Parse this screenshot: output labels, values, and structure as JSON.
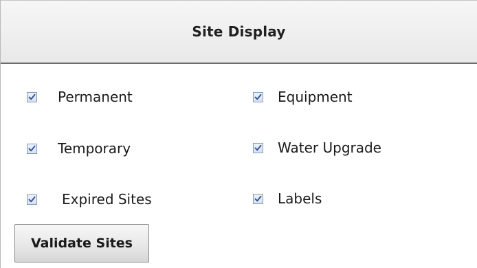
{
  "panel": {
    "title": "Site Display"
  },
  "options": [
    {
      "label": "Permanent",
      "checked": true
    },
    {
      "label": "Equipment",
      "checked": true
    },
    {
      "label": "Temporary",
      "checked": true
    },
    {
      "label": "Water Upgrade",
      "checked": true
    },
    {
      "label": "Expired Sites",
      "checked": true
    },
    {
      "label": "Labels",
      "checked": true
    }
  ],
  "actions": {
    "validate_label": "Validate Sites"
  },
  "colors": {
    "checkmark": "#2b4e9b",
    "checkbox_border": "#7f9db9",
    "header_border": "#6d6d6d"
  },
  "icons": {
    "checkbox": "checkmark-icon"
  }
}
